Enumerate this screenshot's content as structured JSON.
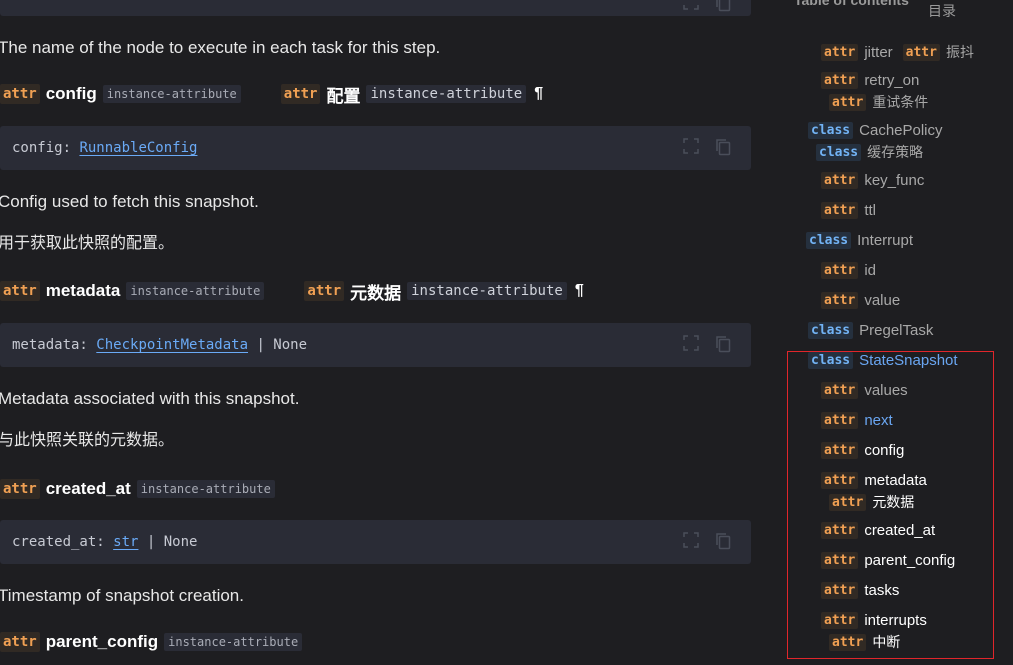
{
  "main": {
    "badge_attr": "attr",
    "label_instance": "instance-attribute",
    "top_desc": "The name of the node to execute in each task for this step.",
    "config": {
      "name": "config",
      "zh_name": "配置",
      "code_name": "config: ",
      "code_type": "RunnableConfig",
      "desc": "Config used to fetch this snapshot.",
      "desc_zh": "用于获取此快照的配置。"
    },
    "metadata": {
      "name": "metadata",
      "zh_name": "元数据",
      "code_name": "metadata: ",
      "code_type": "CheckpointMetadata",
      "code_suffix": " | None",
      "desc": "Metadata associated with this snapshot.",
      "desc_zh": "与此快照关联的元数据。"
    },
    "created_at": {
      "name": "created_at",
      "code_name": "created_at: ",
      "code_type": "str",
      "code_suffix": " | None",
      "desc": "Timestamp of snapshot creation."
    },
    "parent_config": {
      "name": "parent_config"
    },
    "pilcrow": "¶"
  },
  "toc": {
    "title": "Table of contents",
    "title_zh": "目录",
    "items": [
      {
        "kind": "attr",
        "label": "jitter",
        "zh_kind": "attr",
        "zh_label": "振抖"
      },
      {
        "kind": "attr",
        "label": "retry_on",
        "zh_kind": "attr",
        "zh_label": "重试条件"
      },
      {
        "kind": "class",
        "label": "CachePolicy",
        "zh_kind": "class",
        "zh_label": "缓存策略"
      },
      {
        "kind": "attr",
        "label": "key_func"
      },
      {
        "kind": "attr",
        "label": "ttl"
      },
      {
        "kind": "class",
        "label": "Interrupt"
      },
      {
        "kind": "attr",
        "label": "id"
      },
      {
        "kind": "attr",
        "label": "value"
      },
      {
        "kind": "class",
        "label": "PregelTask"
      },
      {
        "kind": "class",
        "label": "StateSnapshot"
      },
      {
        "kind": "attr",
        "label": "values"
      },
      {
        "kind": "attr",
        "label": "next"
      },
      {
        "kind": "attr",
        "label": "config"
      },
      {
        "kind": "attr",
        "label": "metadata",
        "zh_kind": "attr",
        "zh_label": "元数据"
      },
      {
        "kind": "attr",
        "label": "created_at"
      },
      {
        "kind": "attr",
        "label": "parent_config"
      },
      {
        "kind": "attr",
        "label": "tasks"
      },
      {
        "kind": "attr",
        "label": "interrupts",
        "zh_kind": "attr",
        "zh_label": "中断"
      }
    ]
  },
  "colors": {
    "attr_badge": "#f0a053",
    "class_badge": "#72b3f5",
    "link": "#6aaaf6",
    "highlight_border": "#e0262b"
  }
}
